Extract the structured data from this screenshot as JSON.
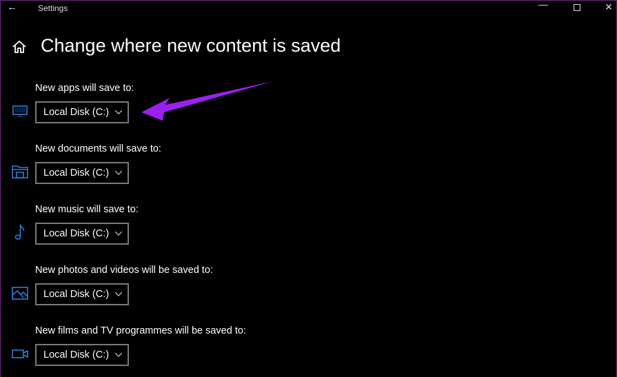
{
  "window": {
    "title": "Settings",
    "back_icon": "arrow-left-icon",
    "controls": [
      "minimize",
      "maximize",
      "close"
    ]
  },
  "page": {
    "title": "Change where new content is saved",
    "home_icon": "home-icon"
  },
  "accent": "#2f7ed8",
  "annotation_color": "#9b1ff0",
  "settings": [
    {
      "label": "New apps will save to:",
      "value": "Local Disk (C:)",
      "icon": "monitor-keyboard-icon"
    },
    {
      "label": "New documents will save to:",
      "value": "Local Disk (C:)",
      "icon": "folder-documents-icon"
    },
    {
      "label": "New music will save to:",
      "value": "Local Disk (C:)",
      "icon": "music-note-icon"
    },
    {
      "label": "New photos and videos will be saved to:",
      "value": "Local Disk (C:)",
      "icon": "image-icon"
    },
    {
      "label": "New films and TV programmes will be saved to:",
      "value": "Local Disk (C:)",
      "icon": "video-camera-icon"
    }
  ]
}
